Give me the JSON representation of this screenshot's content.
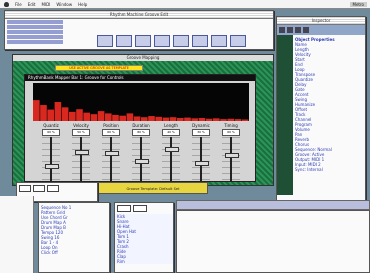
{
  "menubar": {
    "items": [
      "File",
      "Edit",
      "MIDI",
      "Window",
      "Help"
    ],
    "right": "Metro"
  },
  "main_window": {
    "title": "Rhythm Machine Groove Edit",
    "dialog_title": "Groove Mapping",
    "highlight_label": "USE ACTIVE GROOVE AS TEMPLATE",
    "panel_header": "RhythmBank Mapper Bar 1: Groove for Controls",
    "sliders": [
      {
        "name": "Quantiz",
        "value": "60 %",
        "level": 0.15
      },
      {
        "name": "Velocity",
        "value": "50 %",
        "level": 0.6
      },
      {
        "name": "Position",
        "value": "60 %",
        "level": 0.55
      },
      {
        "name": "Duration",
        "value": "80 %",
        "level": 0.3
      },
      {
        "name": "Length",
        "value": "40 %",
        "level": 0.7
      },
      {
        "name": "Dynamic",
        "value": "30 %",
        "level": 0.25
      },
      {
        "name": "Timing",
        "value": "60 %",
        "level": 0.5
      }
    ],
    "bars": [
      0.55,
      0.42,
      0.3,
      0.5,
      0.36,
      0.24,
      0.31,
      0.22,
      0.18,
      0.26,
      0.2,
      0.16,
      0.14,
      0.2,
      0.12,
      0.1,
      0.13,
      0.11,
      0.09,
      0.1,
      0.08,
      0.09,
      0.07,
      0.08,
      0.06,
      0.07,
      0.05,
      0.06,
      0.05,
      0.04
    ]
  },
  "right_panel": {
    "title": "Inspector",
    "header": "Object Properties",
    "lines": [
      "Name",
      "Length",
      "Velocity",
      "Start",
      "End",
      "Loop",
      "Transpose",
      "Quantize",
      "Delay",
      "Gate",
      "Accent",
      "Swing",
      "Humanize",
      "Offset",
      "Track",
      "Channel",
      "Program",
      "Volume",
      "Pan",
      "Reverb",
      "Chorus",
      "Sequence: Normal",
      "Groove: Active",
      "Output: MIDI 1",
      "Input: MIDI 2",
      "Sync: Internal"
    ]
  },
  "bottom_dialog": {
    "label": "Groove Template: Default Set"
  },
  "bottom_left": {
    "lines": [
      "Sequence No 1",
      "Pattern Grid",
      "Use Chord Gr",
      "Drum Map A",
      "Drum Map B",
      "Tempo 120",
      "Swing 16",
      "Bar 1 - 4",
      "Loop On",
      "Click Off"
    ]
  },
  "bottom_center": {
    "list": [
      "Kick",
      "Snare",
      "Hi-Hat",
      "Open Hat",
      "Tom 1",
      "Tom 2",
      "Crash",
      "Ride",
      "Clap",
      "Rim"
    ]
  }
}
